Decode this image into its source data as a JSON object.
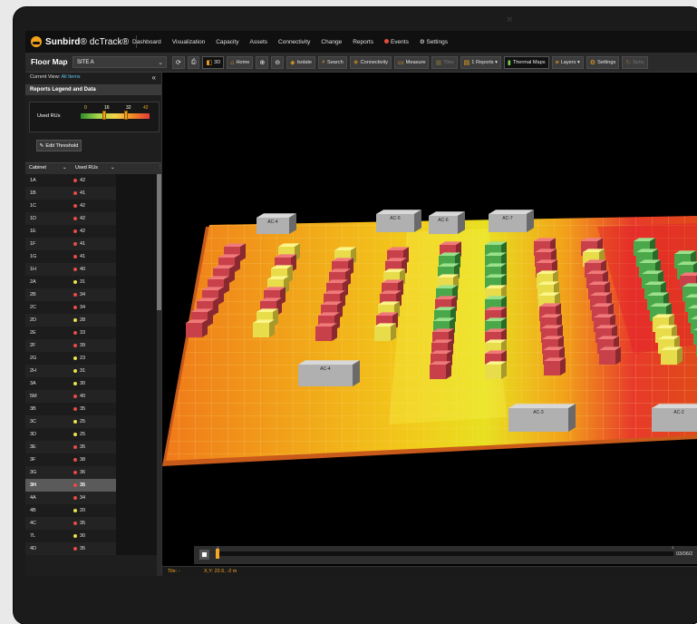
{
  "topnav": {
    "brand_bold": "Sunbird",
    "brand_mark": "®",
    "brand_rest": "dcTrack®",
    "links": [
      {
        "label": "Dashboard",
        "active": false
      },
      {
        "label": "Visualization",
        "active": true
      },
      {
        "label": "Capacity",
        "active": false
      },
      {
        "label": "Assets",
        "active": false
      },
      {
        "label": "Connectivity",
        "active": false
      },
      {
        "label": "Change",
        "active": false
      },
      {
        "label": "Reports",
        "active": false
      },
      {
        "label": "Events",
        "active": false,
        "icon": "alert-dot-icon"
      },
      {
        "label": "Settings",
        "active": false,
        "icon": "gear-icon"
      }
    ]
  },
  "toolbar": {
    "title": "Floor Map",
    "site": "SITE A",
    "buttons": [
      {
        "label": "",
        "icon": "refresh-icon"
      },
      {
        "label": "",
        "icon": "print-icon"
      },
      {
        "label": "3D",
        "icon": "cube-icon",
        "dark": true
      },
      {
        "label": "Home",
        "icon": "home-icon"
      },
      {
        "label": "",
        "icon": "zoom-in-icon"
      },
      {
        "label": "",
        "icon": "zoom-out-icon"
      },
      {
        "label": "Isolate",
        "icon": "isolate-icon"
      },
      {
        "label": "Search",
        "icon": "search-icon"
      },
      {
        "label": "Connectivity",
        "icon": "connectivity-icon"
      },
      {
        "label": "Measure",
        "icon": "measure-icon"
      },
      {
        "label": "Tiles",
        "icon": "tiles-icon",
        "dim": true
      },
      {
        "label": "1 Reports ▾",
        "icon": "reports-icon"
      },
      {
        "label": "Thermal Maps",
        "icon": "thermal-icon",
        "dark": true
      },
      {
        "label": "Layers ▾",
        "icon": "layers-icon"
      },
      {
        "label": "Settings",
        "icon": "gear-icon"
      },
      {
        "label": "Sync",
        "icon": "sync-icon",
        "dim": true
      }
    ]
  },
  "sidebar": {
    "current_view_label": "Current View:",
    "current_view_value": "All Items",
    "legend_title": "Reports Legend and Data",
    "legend_label": "Used RUs",
    "legend_thresholds": [
      "0",
      "16",
      "32",
      "42"
    ],
    "edit_threshold": "Edit Threshold",
    "columns": [
      "Cabinet",
      "Used RUs"
    ],
    "rows": [
      {
        "cabinet": "1A",
        "value": "42",
        "color": "#e84a4a"
      },
      {
        "cabinet": "1B",
        "value": "41",
        "color": "#e84a4a"
      },
      {
        "cabinet": "1C",
        "value": "42",
        "color": "#e84a4a"
      },
      {
        "cabinet": "1D",
        "value": "42",
        "color": "#e84a4a"
      },
      {
        "cabinet": "1E",
        "value": "42",
        "color": "#e84a4a"
      },
      {
        "cabinet": "1F",
        "value": "41",
        "color": "#e84a4a"
      },
      {
        "cabinet": "1G",
        "value": "41",
        "color": "#e84a4a"
      },
      {
        "cabinet": "1H",
        "value": "40",
        "color": "#e84a4a"
      },
      {
        "cabinet": "2A",
        "value": "31",
        "color": "#e8e04a"
      },
      {
        "cabinet": "2B",
        "value": "34",
        "color": "#e84a4a"
      },
      {
        "cabinet": "2C",
        "value": "34",
        "color": "#e84a4a"
      },
      {
        "cabinet": "2D",
        "value": "28",
        "color": "#e8e04a"
      },
      {
        "cabinet": "2E",
        "value": "33",
        "color": "#e84a4a"
      },
      {
        "cabinet": "2F",
        "value": "39",
        "color": "#e84a4a"
      },
      {
        "cabinet": "2G",
        "value": "23",
        "color": "#e8e04a"
      },
      {
        "cabinet": "2H",
        "value": "31",
        "color": "#e8e04a"
      },
      {
        "cabinet": "3A",
        "value": "30",
        "color": "#e8e04a"
      },
      {
        "cabinet": "5M",
        "value": "40",
        "color": "#e84a4a"
      },
      {
        "cabinet": "3B",
        "value": "35",
        "color": "#e84a4a"
      },
      {
        "cabinet": "3C",
        "value": "25",
        "color": "#e8e04a"
      },
      {
        "cabinet": "3D",
        "value": "25",
        "color": "#e8e04a"
      },
      {
        "cabinet": "3E",
        "value": "35",
        "color": "#e84a4a"
      },
      {
        "cabinet": "3F",
        "value": "38",
        "color": "#e84a4a"
      },
      {
        "cabinet": "3G",
        "value": "36",
        "color": "#e84a4a"
      },
      {
        "cabinet": "3H",
        "value": "35",
        "color": "#e84a4a",
        "selected": true
      },
      {
        "cabinet": "4A",
        "value": "34",
        "color": "#e84a4a"
      },
      {
        "cabinet": "4B",
        "value": "20",
        "color": "#e8e04a"
      },
      {
        "cabinet": "4C",
        "value": "35",
        "color": "#e84a4a"
      },
      {
        "cabinet": "7L",
        "value": "30",
        "color": "#e8e04a"
      },
      {
        "cabinet": "4D",
        "value": "35",
        "color": "#e84a4a"
      }
    ]
  },
  "floor": {
    "ac_units": [
      "AC-4",
      "AC-5",
      "AC-6",
      "AC-7",
      "AC-4",
      "AC-3",
      "AC-2"
    ],
    "timeline_start": "1",
    "timeline_end": "1",
    "timeline_date": "03/06/2",
    "status_tile": "Tile:  -",
    "status_xy": "X,Y: 22.6, -2 m"
  }
}
